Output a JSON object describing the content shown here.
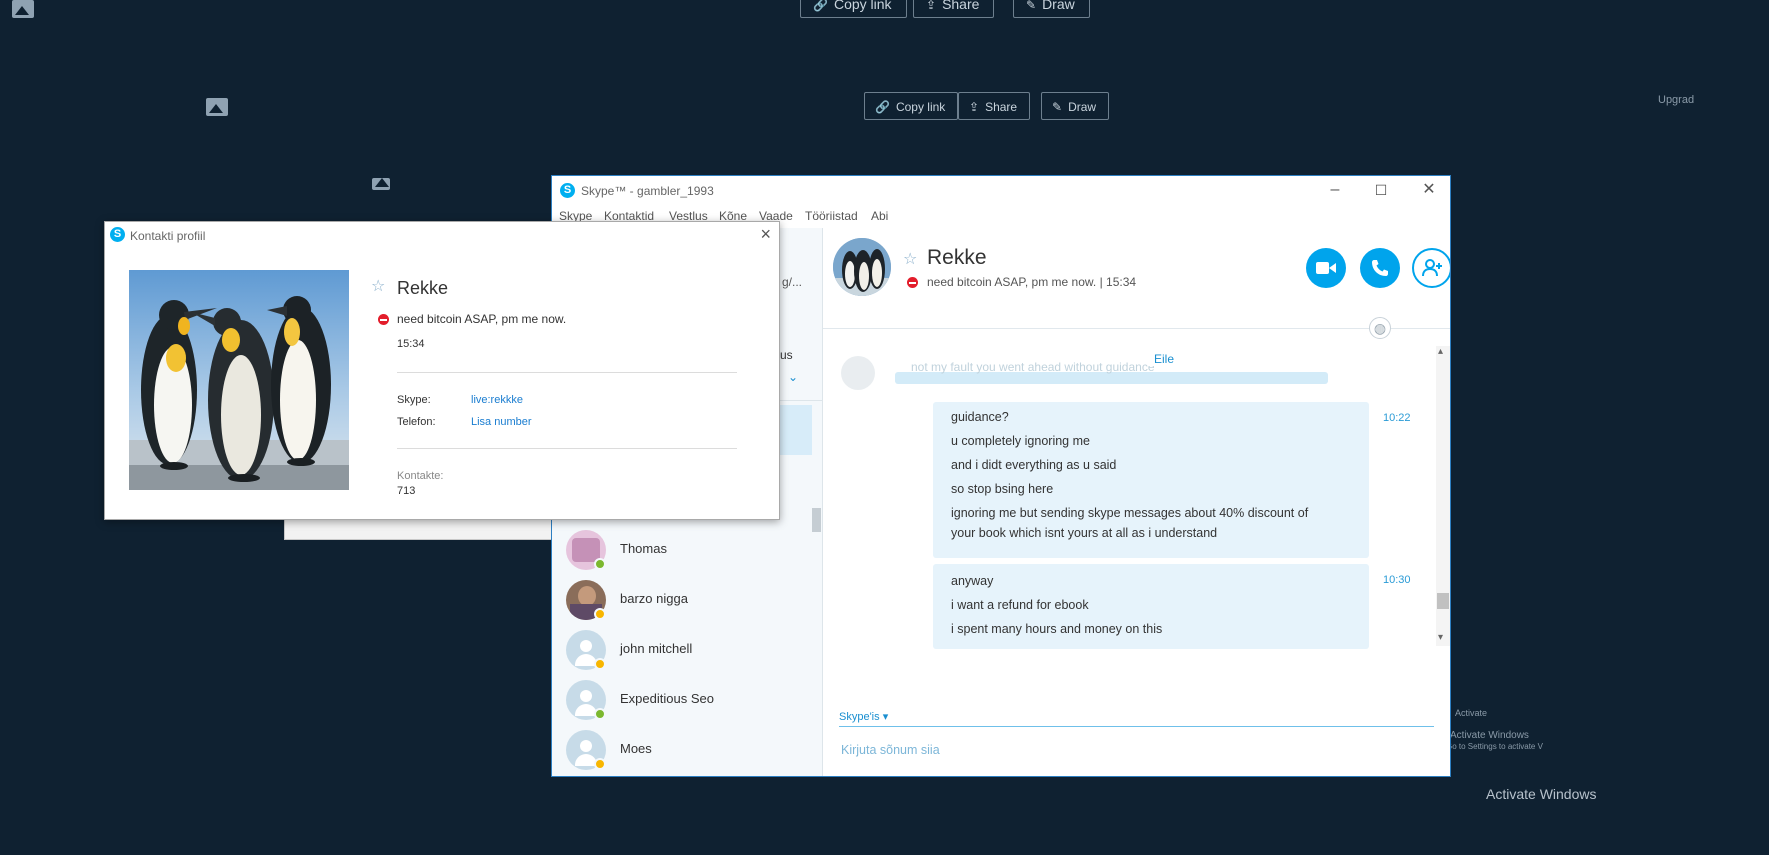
{
  "background": {
    "top_toolbar": [
      "Copy link",
      "Share",
      "Draw"
    ],
    "mid_toolbar": [
      "Copy link",
      "Share",
      "Draw"
    ],
    "upgrade_text": "Upgrad",
    "activate_small": [
      "Activate",
      "Activate Windows",
      "Go to Settings to activate V"
    ],
    "activate_main": "Activate Windows"
  },
  "skype": {
    "window_title": "Skype™ - gambler_1993",
    "menu": [
      "Skype",
      "Kontaktid",
      "Vestlus",
      "Kõne",
      "Vaade",
      "Tööriistad",
      "Abi"
    ],
    "sidebar_fragments": {
      "g": "g/...",
      "us": "us"
    },
    "contacts": [
      {
        "name": "Thomas",
        "status": "online"
      },
      {
        "name": "barzo nigga",
        "status": "away"
      },
      {
        "name": "john mitchell",
        "status": "away"
      },
      {
        "name": "Expeditious Seo",
        "status": "online"
      },
      {
        "name": "Moes",
        "status": "away"
      }
    ],
    "chat": {
      "name": "Rekke",
      "mood": "need bitcoin ASAP, pm me now.",
      "mood_time": "| 15:34",
      "day_label": "Eile",
      "faded_message": "not my fault you went ahead without guidance",
      "messages_group1": [
        "guidance?",
        "u completely ignoring me",
        "and i didt everything as u said",
        "so stop bsing here",
        "ignoring me but sending skype messages about 40% discount of",
        "your book which isnt yours at all as i understand"
      ],
      "time1": "10:22",
      "messages_group2": [
        "anyway",
        "i want a refund for ebook",
        "i spent many hours and money on this"
      ],
      "time2": "10:30",
      "composer_label": "Skype'is",
      "composer_placeholder": "Kirjuta sõnum siia"
    }
  },
  "profile": {
    "title": "Kontakti profiil",
    "name": "Rekke",
    "mood": "need bitcoin ASAP, pm me now.",
    "time": "15:34",
    "skype_label": "Skype:",
    "skype_value": "live:rekkke",
    "phone_label": "Telefon:",
    "phone_value": "Lisa number",
    "contacts_label": "Kontakte:",
    "contacts_value": "713"
  },
  "colors": {
    "desktop_bg": "#0f2131",
    "skype_blue": "#00a4ec",
    "bubble": "#e6f3fb",
    "dnd_red": "#e31d2b",
    "online_green": "#7cb82f",
    "away_yellow": "#f8b600"
  }
}
